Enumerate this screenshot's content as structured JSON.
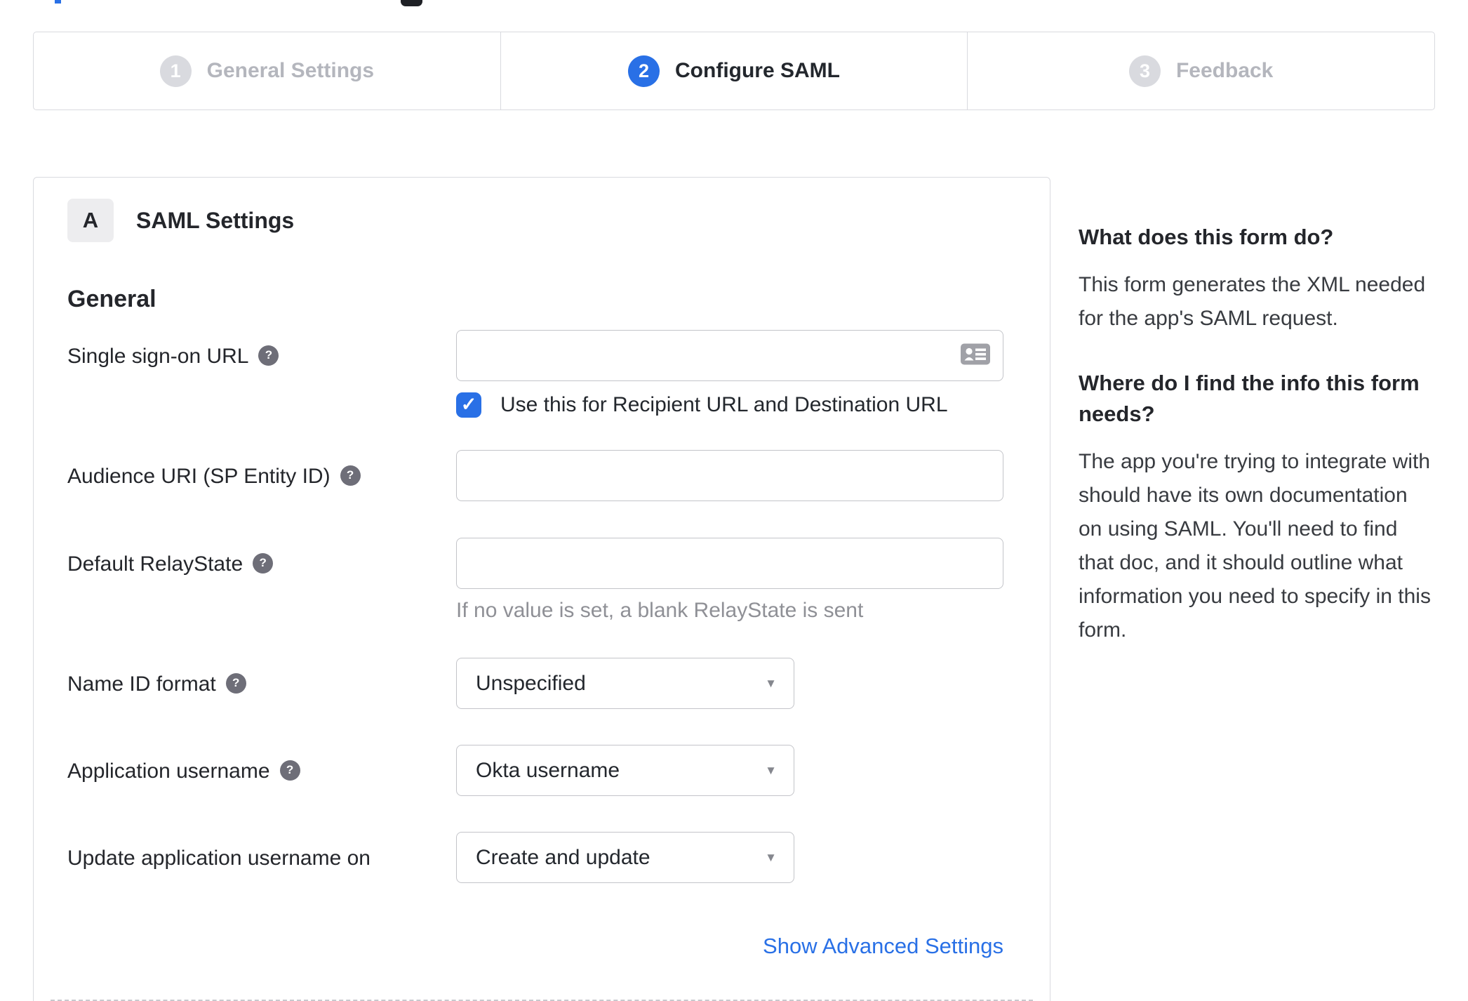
{
  "colors": {
    "accent_blue": "#2970e6",
    "inactive_gray": "#d9dadf",
    "help_icon_gray": "#6e6e78"
  },
  "icons": {
    "help": "?",
    "check": "✓",
    "caret": "▼",
    "input_addon": "contact-card-icon"
  },
  "stepper": {
    "steps": [
      {
        "number": "1",
        "label": "General Settings",
        "active": false
      },
      {
        "number": "2",
        "label": "Configure SAML",
        "active": true
      },
      {
        "number": "3",
        "label": "Feedback",
        "active": false
      }
    ]
  },
  "form": {
    "section_badge": "A",
    "section_title": "SAML Settings",
    "group_heading": "General",
    "fields": [
      {
        "label": "Single sign-on URL",
        "value": "",
        "checkbox": {
          "label": "Use this for Recipient URL and Destination URL",
          "checked": true
        }
      },
      {
        "label": "Audience URI (SP Entity ID)",
        "value": ""
      },
      {
        "label": "Default RelayState",
        "value": "",
        "hint": "If no value is set, a blank RelayState is sent"
      },
      {
        "label": "Name ID format",
        "value": "Unspecified"
      },
      {
        "label": "Application username",
        "value": "Okta username"
      },
      {
        "label": "Update application username on",
        "value": "Create and update"
      }
    ],
    "advanced_link": "Show Advanced Settings"
  },
  "help_panel": {
    "sections": [
      {
        "heading": "What does this form do?",
        "body": "This form generates the XML needed for the app's SAML request."
      },
      {
        "heading": "Where do I find the info this form needs?",
        "body": "The app you're trying to integrate with should have its own documentation on using SAML. You'll need to find that doc, and it should outline what information you need to specify in this form."
      }
    ]
  }
}
